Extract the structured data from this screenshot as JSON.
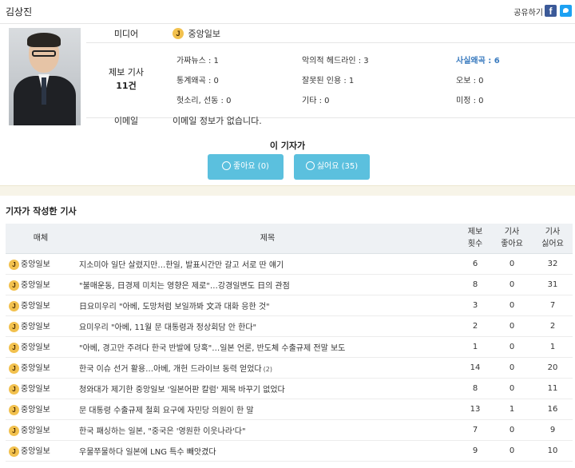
{
  "reporter": {
    "name": "김상진"
  },
  "share": {
    "label": "공유하기",
    "facebook_icon": "facebook-icon",
    "twitter_icon": "twitter-icon"
  },
  "profile": {
    "media_label": "미디어",
    "media_logo": "J",
    "media_name": "중앙일보",
    "report_label_line1": "제보 기사",
    "report_label_line2": "11건",
    "stats": [
      {
        "label": "가짜뉴스 : 1"
      },
      {
        "label": "악의적 헤드라인 : 3"
      },
      {
        "label": "사실왜곡 : 6"
      },
      {
        "label": "통계왜곡 : 0"
      },
      {
        "label": "잘못된 인용 : 1"
      },
      {
        "label": "오보 : 0"
      },
      {
        "label": "헛소리, 선동 : 0"
      },
      {
        "label": "기타 : 0"
      },
      {
        "label": "미정 : 0"
      }
    ],
    "email_label": "이메일",
    "email_value": "이메일 정보가 없습니다."
  },
  "likes": {
    "title": "이 기자가",
    "like_button": "좋아요 (0)",
    "dislike_button": "싫어요 (35)"
  },
  "articles": {
    "section_title": "기자가 작성한 기사",
    "headers": {
      "media": "매체",
      "title": "제목",
      "reports": "제보\n횟수",
      "likes": "기사\n좋아요",
      "dislikes": "기사\n싫어요"
    },
    "rows": [
      {
        "media": "중앙일보",
        "title": "지소미아 일단 살렸지만…한일, 발표시간만 갈고 서로 딴 얘기",
        "badge": "",
        "reports": "6",
        "likes": "0",
        "dislikes": "32"
      },
      {
        "media": "중앙일보",
        "title": "\"불매운동, 日경제 미치는 영향은 제로\"…강경일변도 日의 관점",
        "badge": "",
        "reports": "8",
        "likes": "0",
        "dislikes": "31"
      },
      {
        "media": "중앙일보",
        "title": "日요미우리 \"아베, 도망처럼 보일까봐 文과 대화 응한 것\"",
        "badge": "",
        "reports": "3",
        "likes": "0",
        "dislikes": "7"
      },
      {
        "media": "중앙일보",
        "title": "요미우리 \"아베, 11월 문 대통령과 정상회담 안 한다\"",
        "badge": "",
        "reports": "2",
        "likes": "0",
        "dislikes": "2"
      },
      {
        "media": "중앙일보",
        "title": "\"아베, 경고만 주려다 한국 반발에 당혹\"…일본 언론, 반도체 수출규제 전말 보도",
        "badge": "",
        "reports": "1",
        "likes": "0",
        "dislikes": "1"
      },
      {
        "media": "중앙일보",
        "title": "한국 이슈 선거 활용…아베, 개헌 드라이브 동력 얻었다",
        "badge": "(2)",
        "reports": "14",
        "likes": "0",
        "dislikes": "20"
      },
      {
        "media": "중앙일보",
        "title": "청와대가 제기한 중앙일보 '일본어판 칼럼' 제목 바꾸기 없었다",
        "badge": "",
        "reports": "8",
        "likes": "0",
        "dislikes": "11"
      },
      {
        "media": "중앙일보",
        "title": "문 대통령 수출규제 철회 요구에 자민당 의원이 한 말",
        "badge": "",
        "reports": "13",
        "likes": "1",
        "dislikes": "16"
      },
      {
        "media": "중앙일보",
        "title": "한국 패싱하는 일본, \"중국은 '영원한 이웃나라'다\"",
        "badge": "",
        "reports": "7",
        "likes": "0",
        "dislikes": "9"
      },
      {
        "media": "중앙일보",
        "title": "우물쭈물하다 일본에 LNG 특수 빼앗겼다",
        "badge": "",
        "reports": "9",
        "likes": "0",
        "dislikes": "10"
      }
    ]
  },
  "colors": {
    "accent_button": "#5bc0de",
    "highlight_stat": "#3a7bbf",
    "header_bg": "#eef1f4"
  }
}
